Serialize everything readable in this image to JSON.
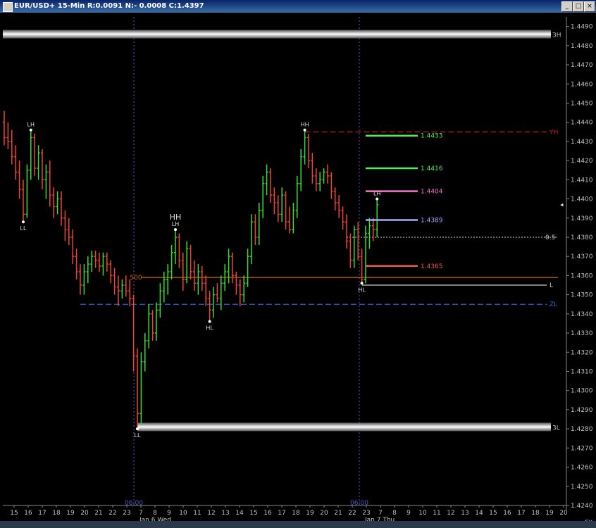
{
  "window": {
    "title": "EUR/USD+ 15-Min R:0.0091 N:- 0.0008 C:1.4397",
    "buttons": {
      "minimize": "_",
      "maximize": "□",
      "close": "×"
    },
    "corner_label": "FX",
    "current_price_marker": "◂"
  },
  "colors": {
    "background": "#000000",
    "up_bar": "#33dd33",
    "down_bar": "#ee4433",
    "axis_text": "#c0c0c0",
    "session_line": "#5555cc",
    "level_500": "#cc6600",
    "zl_line": "#2266dd",
    "yh_line": "#cc2222"
  },
  "chart_data": {
    "type": "ohlc",
    "y_range": [
      1.424,
      1.4495
    ],
    "y_ticks": [
      "1.4490",
      "1.4480",
      "1.4470",
      "1.4460",
      "1.4450",
      "1.4440",
      "1.4430",
      "1.4420",
      "1.4410",
      "1.4400",
      "1.4390",
      "1.4380",
      "1.4370",
      "1.4360",
      "1.4350",
      "1.4340",
      "1.4330",
      "1.4320",
      "1.4310",
      "1.4300",
      "1.4290",
      "1.4280",
      "1.4270",
      "1.4260",
      "1.4250",
      "1.4240"
    ],
    "x_hour_labels": [
      "15",
      "16",
      "17",
      "18",
      "19",
      "20",
      "21",
      "22",
      "23",
      "7",
      "8",
      "9",
      "10",
      "11",
      "12",
      "13",
      "14",
      "15",
      "16",
      "17",
      "18",
      "19",
      "20",
      "21",
      "22",
      "23",
      "7",
      "8",
      "9",
      "10",
      "11",
      "12",
      "13",
      "14",
      "15",
      "16",
      "17",
      "18",
      "19",
      "20"
    ],
    "x_date_labels": [
      {
        "text": "Jan 6 Wed",
        "hour_index": 10
      },
      {
        "text": "Jan 7 Thu",
        "hour_index": 26
      }
    ],
    "sessions": [
      {
        "label": "06:00",
        "hour_index": 8.5
      },
      {
        "label": "06:00",
        "hour_index": 24.5
      }
    ],
    "current_price": 1.4397,
    "bars": [
      {
        "o": 1.444,
        "h": 1.4446,
        "l": 1.4428,
        "c": 1.4432
      },
      {
        "o": 1.4432,
        "h": 1.444,
        "l": 1.4426,
        "c": 1.443
      },
      {
        "o": 1.443,
        "h": 1.4436,
        "l": 1.4418,
        "c": 1.4422
      },
      {
        "o": 1.4422,
        "h": 1.4428,
        "l": 1.441,
        "c": 1.4414
      },
      {
        "o": 1.4414,
        "h": 1.442,
        "l": 1.44,
        "c": 1.4405
      },
      {
        "o": 1.4405,
        "h": 1.441,
        "l": 1.4388,
        "c": 1.4392
      },
      {
        "o": 1.4392,
        "h": 1.4418,
        "l": 1.439,
        "c": 1.4415
      },
      {
        "o": 1.4415,
        "h": 1.4436,
        "l": 1.441,
        "c": 1.4432
      },
      {
        "o": 1.4432,
        "h": 1.4434,
        "l": 1.4412,
        "c": 1.4416
      },
      {
        "o": 1.4416,
        "h": 1.4428,
        "l": 1.441,
        "c": 1.4424
      },
      {
        "o": 1.4424,
        "h": 1.4426,
        "l": 1.4405,
        "c": 1.441
      },
      {
        "o": 1.441,
        "h": 1.4418,
        "l": 1.44,
        "c": 1.4414
      },
      {
        "o": 1.4414,
        "h": 1.442,
        "l": 1.4396,
        "c": 1.4402
      },
      {
        "o": 1.4402,
        "h": 1.4406,
        "l": 1.439,
        "c": 1.4396
      },
      {
        "o": 1.4396,
        "h": 1.4404,
        "l": 1.4392,
        "c": 1.44
      },
      {
        "o": 1.44,
        "h": 1.4404,
        "l": 1.4386,
        "c": 1.439
      },
      {
        "o": 1.439,
        "h": 1.4394,
        "l": 1.4378,
        "c": 1.4384
      },
      {
        "o": 1.4384,
        "h": 1.439,
        "l": 1.4376,
        "c": 1.438
      },
      {
        "o": 1.438,
        "h": 1.4384,
        "l": 1.4366,
        "c": 1.437
      },
      {
        "o": 1.437,
        "h": 1.4374,
        "l": 1.4358,
        "c": 1.4362
      },
      {
        "o": 1.4362,
        "h": 1.4366,
        "l": 1.435,
        "c": 1.4355
      },
      {
        "o": 1.4355,
        "h": 1.4366,
        "l": 1.435,
        "c": 1.4362
      },
      {
        "o": 1.4362,
        "h": 1.437,
        "l": 1.4356,
        "c": 1.4366
      },
      {
        "o": 1.4366,
        "h": 1.4373,
        "l": 1.4362,
        "c": 1.437
      },
      {
        "o": 1.437,
        "h": 1.4373,
        "l": 1.4364,
        "c": 1.4368
      },
      {
        "o": 1.4368,
        "h": 1.4372,
        "l": 1.4362,
        "c": 1.4365
      },
      {
        "o": 1.4365,
        "h": 1.4372,
        "l": 1.436,
        "c": 1.437
      },
      {
        "o": 1.437,
        "h": 1.4372,
        "l": 1.4362,
        "c": 1.4366
      },
      {
        "o": 1.4366,
        "h": 1.4368,
        "l": 1.4356,
        "c": 1.436
      },
      {
        "o": 1.436,
        "h": 1.4364,
        "l": 1.435,
        "c": 1.4354
      },
      {
        "o": 1.4354,
        "h": 1.436,
        "l": 1.4344,
        "c": 1.4352
      },
      {
        "o": 1.4352,
        "h": 1.4358,
        "l": 1.4348,
        "c": 1.4355
      },
      {
        "o": 1.4355,
        "h": 1.436,
        "l": 1.4349,
        "c": 1.4352
      },
      {
        "o": 1.4352,
        "h": 1.4358,
        "l": 1.4344,
        "c": 1.4348
      },
      {
        "o": 1.4348,
        "h": 1.435,
        "l": 1.431,
        "c": 1.4318
      },
      {
        "o": 1.4318,
        "h": 1.4322,
        "l": 1.428,
        "c": 1.4288
      },
      {
        "o": 1.4288,
        "h": 1.432,
        "l": 1.4282,
        "c": 1.4315
      },
      {
        "o": 1.4315,
        "h": 1.433,
        "l": 1.431,
        "c": 1.4326
      },
      {
        "o": 1.4326,
        "h": 1.4345,
        "l": 1.4322,
        "c": 1.434
      },
      {
        "o": 1.434,
        "h": 1.4342,
        "l": 1.4326,
        "c": 1.433
      },
      {
        "o": 1.433,
        "h": 1.4346,
        "l": 1.4326,
        "c": 1.4342
      },
      {
        "o": 1.4342,
        "h": 1.4356,
        "l": 1.4338,
        "c": 1.4352
      },
      {
        "o": 1.4352,
        "h": 1.4362,
        "l": 1.4346,
        "c": 1.4358
      },
      {
        "o": 1.4358,
        "h": 1.4366,
        "l": 1.435,
        "c": 1.4362
      },
      {
        "o": 1.4362,
        "h": 1.4376,
        "l": 1.4358,
        "c": 1.4372
      },
      {
        "o": 1.4372,
        "h": 1.4384,
        "l": 1.4366,
        "c": 1.438
      },
      {
        "o": 1.438,
        "h": 1.4382,
        "l": 1.4364,
        "c": 1.4368
      },
      {
        "o": 1.4368,
        "h": 1.4372,
        "l": 1.4352,
        "c": 1.4358
      },
      {
        "o": 1.4358,
        "h": 1.4378,
        "l": 1.4356,
        "c": 1.4374
      },
      {
        "o": 1.4374,
        "h": 1.4376,
        "l": 1.4358,
        "c": 1.4362
      },
      {
        "o": 1.4362,
        "h": 1.4368,
        "l": 1.4352,
        "c": 1.4356
      },
      {
        "o": 1.4356,
        "h": 1.4366,
        "l": 1.435,
        "c": 1.4362
      },
      {
        "o": 1.4362,
        "h": 1.4365,
        "l": 1.4352,
        "c": 1.4356
      },
      {
        "o": 1.4356,
        "h": 1.436,
        "l": 1.4344,
        "c": 1.4348
      },
      {
        "o": 1.4348,
        "h": 1.4352,
        "l": 1.4336,
        "c": 1.4342
      },
      {
        "o": 1.4342,
        "h": 1.4354,
        "l": 1.4338,
        "c": 1.435
      },
      {
        "o": 1.435,
        "h": 1.4356,
        "l": 1.4346,
        "c": 1.4348
      },
      {
        "o": 1.4348,
        "h": 1.436,
        "l": 1.4342,
        "c": 1.4356
      },
      {
        "o": 1.4356,
        "h": 1.4366,
        "l": 1.4352,
        "c": 1.4362
      },
      {
        "o": 1.4362,
        "h": 1.4374,
        "l": 1.4356,
        "c": 1.437
      },
      {
        "o": 1.437,
        "h": 1.4372,
        "l": 1.4356,
        "c": 1.436
      },
      {
        "o": 1.436,
        "h": 1.4362,
        "l": 1.435,
        "c": 1.4355
      },
      {
        "o": 1.4355,
        "h": 1.4358,
        "l": 1.4344,
        "c": 1.435
      },
      {
        "o": 1.435,
        "h": 1.436,
        "l": 1.4346,
        "c": 1.4356
      },
      {
        "o": 1.4356,
        "h": 1.4374,
        "l": 1.4354,
        "c": 1.437
      },
      {
        "o": 1.437,
        "h": 1.4392,
        "l": 1.4366,
        "c": 1.4388
      },
      {
        "o": 1.4388,
        "h": 1.4392,
        "l": 1.4376,
        "c": 1.438
      },
      {
        "o": 1.438,
        "h": 1.4398,
        "l": 1.4376,
        "c": 1.4394
      },
      {
        "o": 1.4394,
        "h": 1.4412,
        "l": 1.439,
        "c": 1.4408
      },
      {
        "o": 1.4408,
        "h": 1.4418,
        "l": 1.4402,
        "c": 1.4414
      },
      {
        "o": 1.4414,
        "h": 1.4416,
        "l": 1.4398,
        "c": 1.4402
      },
      {
        "o": 1.4402,
        "h": 1.4406,
        "l": 1.4392,
        "c": 1.4398
      },
      {
        "o": 1.4398,
        "h": 1.4402,
        "l": 1.4388,
        "c": 1.4392
      },
      {
        "o": 1.4392,
        "h": 1.4406,
        "l": 1.4388,
        "c": 1.4402
      },
      {
        "o": 1.4402,
        "h": 1.4404,
        "l": 1.4384,
        "c": 1.4388
      },
      {
        "o": 1.4388,
        "h": 1.4396,
        "l": 1.4382,
        "c": 1.4384
      },
      {
        "o": 1.4384,
        "h": 1.4398,
        "l": 1.4382,
        "c": 1.4394
      },
      {
        "o": 1.4394,
        "h": 1.4412,
        "l": 1.439,
        "c": 1.4408
      },
      {
        "o": 1.4408,
        "h": 1.4426,
        "l": 1.4404,
        "c": 1.4422
      },
      {
        "o": 1.4422,
        "h": 1.4436,
        "l": 1.4418,
        "c": 1.4432
      },
      {
        "o": 1.4432,
        "h": 1.4434,
        "l": 1.4416,
        "c": 1.442
      },
      {
        "o": 1.442,
        "h": 1.4424,
        "l": 1.4408,
        "c": 1.4412
      },
      {
        "o": 1.4412,
        "h": 1.4416,
        "l": 1.4404,
        "c": 1.4408
      },
      {
        "o": 1.4408,
        "h": 1.4414,
        "l": 1.4404,
        "c": 1.441
      },
      {
        "o": 1.441,
        "h": 1.4416,
        "l": 1.4408,
        "c": 1.4414
      },
      {
        "o": 1.4414,
        "h": 1.4418,
        "l": 1.4408,
        "c": 1.4412
      },
      {
        "o": 1.4412,
        "h": 1.4414,
        "l": 1.44,
        "c": 1.4404
      },
      {
        "o": 1.4404,
        "h": 1.4406,
        "l": 1.4394,
        "c": 1.4398
      },
      {
        "o": 1.4398,
        "h": 1.4402,
        "l": 1.439,
        "c": 1.4394
      },
      {
        "o": 1.4394,
        "h": 1.4396,
        "l": 1.4384,
        "c": 1.4388
      },
      {
        "o": 1.4388,
        "h": 1.4392,
        "l": 1.4374,
        "c": 1.4378
      },
      {
        "o": 1.4378,
        "h": 1.4382,
        "l": 1.4364,
        "c": 1.4368
      },
      {
        "o": 1.4368,
        "h": 1.4386,
        "l": 1.4364,
        "c": 1.4384
      },
      {
        "o": 1.4384,
        "h": 1.4388,
        "l": 1.4368,
        "c": 1.437
      },
      {
        "o": 1.437,
        "h": 1.4374,
        "l": 1.4356,
        "c": 1.4358
      },
      {
        "o": 1.4358,
        "h": 1.4386,
        "l": 1.4356,
        "c": 1.4382
      },
      {
        "o": 1.4382,
        "h": 1.439,
        "l": 1.4374,
        "c": 1.4386
      },
      {
        "o": 1.4386,
        "h": 1.439,
        "l": 1.4378,
        "c": 1.4384
      },
      {
        "o": 1.4384,
        "h": 1.44,
        "l": 1.438,
        "c": 1.4397
      }
    ],
    "levels": [
      {
        "name": "3H",
        "price": 1.4486,
        "style": "band",
        "label": "3H"
      },
      {
        "name": "YH",
        "price": 1.4435,
        "style": "dashed",
        "color": "#cc2222",
        "label": "YH"
      },
      {
        "name": "0.5",
        "price": 1.438,
        "style": "dotted",
        "color": "#aaaaaa",
        "label": "0.5"
      },
      {
        "name": "500",
        "price": 1.4359,
        "style": "solid",
        "color": "#cc6600",
        "label": "500"
      },
      {
        "name": "L",
        "price": 1.4355,
        "style": "solid",
        "color": "#cccccc",
        "label": "L"
      },
      {
        "name": "ZL",
        "price": 1.4345,
        "style": "dashed",
        "color": "#2266dd",
        "label": "ZL"
      },
      {
        "name": "3L",
        "price": 1.4281,
        "style": "band",
        "label": "3L"
      }
    ],
    "targets": [
      {
        "price": 1.4433,
        "label": "1.4433",
        "color": "#55ee55"
      },
      {
        "price": 1.4416,
        "label": "1.4416",
        "color": "#55ee55"
      },
      {
        "price": 1.4404,
        "label": "1.4404",
        "color": "#ee77cc"
      },
      {
        "price": 1.4389,
        "label": "1.4389",
        "color": "#aaaaff"
      },
      {
        "price": 1.4365,
        "label": "1.4365",
        "color": "#ee5555"
      }
    ],
    "swing_labels": [
      {
        "text": "LH",
        "bar": 7,
        "price": 1.4436,
        "pos": "above"
      },
      {
        "text": "LL",
        "bar": 5,
        "price": 1.4388,
        "pos": "below"
      },
      {
        "text": "HH",
        "bar": 45,
        "price": 1.4384,
        "pos": "above2"
      },
      {
        "text": "LH",
        "bar": 45,
        "price": 1.4384,
        "pos": "above"
      },
      {
        "text": "HL",
        "bar": 54,
        "price": 1.4336,
        "pos": "below"
      },
      {
        "text": "LL",
        "bar": 35,
        "price": 1.428,
        "pos": "below"
      },
      {
        "text": "HH",
        "bar": 79,
        "price": 1.4436,
        "pos": "above"
      },
      {
        "text": "HL",
        "bar": 94,
        "price": 1.4356,
        "pos": "below"
      },
      {
        "text": "LH",
        "bar": 98,
        "price": 1.44,
        "pos": "above"
      }
    ]
  }
}
